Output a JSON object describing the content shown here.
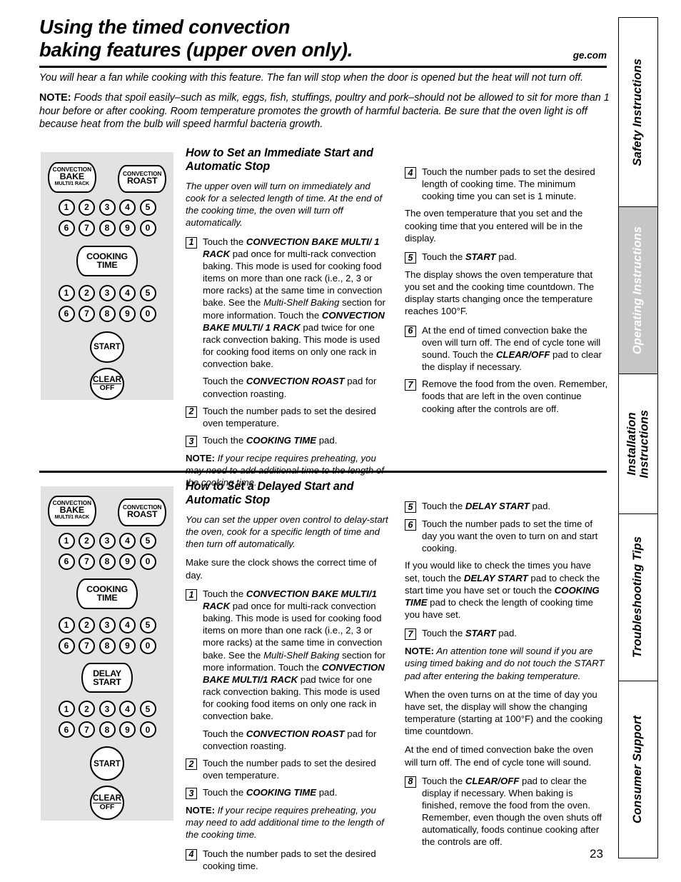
{
  "header": {
    "title_line1": "Using the timed convection",
    "title_line2": "baking features (upper oven only).",
    "site": "ge.com"
  },
  "intro": {
    "para1": "You will hear a fan while cooking with this feature. The fan will stop when the door is opened but the heat will not turn off.",
    "note_label": "NOTE:",
    "note_text": " Foods that spoil easily–such as milk, eggs, fish, stuffings, poultry and pork–should not be allowed to sit for more than 1 hour before or after cooking. Room temperature promotes the growth of harmful bacteria. Be sure that the oven light is off because heat from the bulb will speed harmful bacteria growth."
  },
  "control_panel": {
    "convection_bake": {
      "line1": "CONVECTION",
      "line2": "BAKE",
      "line3": "MULTI/1 RACK"
    },
    "convection_roast": {
      "line1": "CONVECTION",
      "line2": "ROAST"
    },
    "cooking_time": {
      "line1": "COOKING",
      "line2": "TIME"
    },
    "delay_start": {
      "line1": "DELAY",
      "line2": "START"
    },
    "start": "START",
    "clear_off": {
      "line1": "CLEAR",
      "line2": "OFF"
    },
    "number_row_a": [
      "1",
      "2",
      "3",
      "4",
      "5"
    ],
    "number_row_b": [
      "6",
      "7",
      "8",
      "9",
      "0"
    ]
  },
  "section1": {
    "heading": "How to Set an Immediate Start and Automatic Stop",
    "lead": "The upper oven will turn on immediately and cook for a selected length of time. At the end of the cooking time, the oven will turn off automatically.",
    "step1_num": "1",
    "step1_a_pre": "Touch the ",
    "step1_a_bold": "CONVECTION BAKE MULTI/ 1 RACK",
    "step1_a_mid": " pad once for multi-rack convection baking. This mode is used for cooking food items on more than one rack (i.e., 2, 3 or more racks) at the same time in convection bake. See the ",
    "step1_a_ital": "Multi-Shelf Baking",
    "step1_a_mid2": " section for more information. Touch the ",
    "step1_a_bold2": "CONVECTION BAKE MULTI/ 1 RACK",
    "step1_a_end": " pad twice for one rack convection baking. This mode is used for cooking food items on only one rack in convection bake.",
    "step1_b_pre": "Touch the ",
    "step1_b_bold": "CONVECTION ROAST",
    "step1_b_end": " pad for convection roasting.",
    "step2_num": "2",
    "step2_text": "Touch the number pads to set the desired oven temperature.",
    "step3_num": "3",
    "step3_pre": "Touch the ",
    "step3_bold": "COOKING TIME",
    "step3_end": " pad.",
    "note1_label": "NOTE:",
    "note1_text": " If your recipe requires preheating, you may need to add additional time to the length of the cooking time.",
    "step4_num": "4",
    "step4_text": "Touch the number pads to set the desired length of cooking time. The minimum cooking time you can set is 1 minute.",
    "para_after4": "The oven temperature that you set and the cooking time that you entered will be in the display.",
    "step5_num": "5",
    "step5_pre": "Touch the ",
    "step5_bold": "START",
    "step5_end": " pad.",
    "para_after5": "The display shows the oven temperature that you set and the cooking time countdown. The display starts changing once the temperature reaches 100°F.",
    "step6_num": "6",
    "step6_pre": "At the end of timed convection bake the oven will turn off. The end of cycle tone will sound. Touch the ",
    "step6_bold": "CLEAR/OFF",
    "step6_end": " pad to clear the display if necessary.",
    "step7_num": "7",
    "step7_text": "Remove the food from the oven. Remember, foods that are left in the oven continue cooking after the controls are off."
  },
  "section2": {
    "heading": "How to Set a Delayed Start and Automatic Stop",
    "lead": "You can set the upper oven control to delay-start the oven, cook for a specific length of time and then turn off automatically.",
    "clock_note": "Make sure the clock shows the correct time of day.",
    "step1_num": "1",
    "step1_a_pre": "Touch the ",
    "step1_a_bold": "CONVECTION BAKE MULTI/1 RACK",
    "step1_a_mid": " pad once for multi-rack convection baking. This mode is used for cooking food items on more than one rack (i.e., 2, 3 or more racks) at the same time in convection bake. See the ",
    "step1_a_ital": "Multi-Shelf Baking",
    "step1_a_mid2": " section for more information. Touch the ",
    "step1_a_bold2": "CONVECTION BAKE MULTI/1 RACK",
    "step1_a_end": " pad twice for one rack convection baking. This mode is used for cooking food items on only one rack in convection bake.",
    "step1_b_pre": "Touch the ",
    "step1_b_bold": "CONVECTION ROAST",
    "step1_b_end": " pad for convection roasting.",
    "step2_num": "2",
    "step2_text": "Touch the number pads to set the desired oven temperature.",
    "step3_num": "3",
    "step3_pre": "Touch the ",
    "step3_bold": "COOKING TIME",
    "step3_end": " pad.",
    "note1_label": "NOTE:",
    "note1_text": " If your recipe requires preheating, you may need to add additional time to the length of the cooking time.",
    "step4_num": "4",
    "step4_text": "Touch the number pads to set the desired cooking time.",
    "step5_num": "5",
    "step5_pre": "Touch the ",
    "step5_bold": "DELAY START",
    "step5_end": " pad.",
    "step6_num": "6",
    "step6_text": "Touch the number pads to set the time of day you want the oven to turn on and start cooking.",
    "check_pre": "If you would like to check the times you have set, touch the ",
    "check_bold1": "DELAY START",
    "check_mid": " pad to check the start time you have set or touch the ",
    "check_bold2": "COOKING TIME",
    "check_end": " pad to check the length of cooking time you have set.",
    "step7_num": "7",
    "step7_pre": "Touch the ",
    "step7_bold": "START",
    "step7_end": " pad.",
    "note2_label": "NOTE:",
    "note2_text": " An attention tone will sound if you are using timed baking and do not touch the START pad after entering the baking temperature.",
    "para_turnon": "When the oven turns on at the time of day you have set, the display will show the changing temperature (starting at 100°F) and the cooking time countdown.",
    "para_end": "At the end of timed convection bake the oven will turn off. The end of cycle tone will sound.",
    "step8_num": "8",
    "step8_pre": "Touch the ",
    "step8_bold": "CLEAR/OFF",
    "step8_end": " pad to clear the display if necessary. When baking is finished, remove the food from the oven. Remember, even though the oven shuts off automatically, foods continue cooking after the controls are off."
  },
  "tabs": [
    {
      "label": "Safety Instructions",
      "active": false
    },
    {
      "label": "Operating Instructions",
      "active": true
    },
    {
      "label": "Installation\nInstructions",
      "active": false
    },
    {
      "label": "Troubleshooting Tips",
      "active": false
    },
    {
      "label": "Consumer Support",
      "active": false
    }
  ],
  "page_number": "23"
}
